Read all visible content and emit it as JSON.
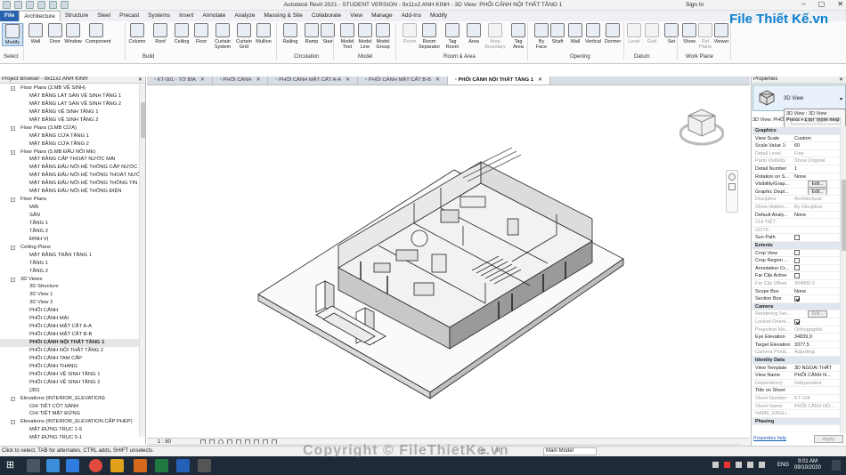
{
  "title_bar": {
    "title": "Autodesk Revit 2021 - STUDENT VERSION - 9x11x2 ANH KINH - 3D View: PHỐI CẢNH NỘI THẤT TẦNG 1",
    "sign_in": "Sign In"
  },
  "logo": "File Thiết Kế.vn",
  "tabs": [
    "File",
    "Architecture",
    "Structure",
    "Steel",
    "Precast",
    "Systems",
    "Insert",
    "Annotate",
    "Analyze",
    "Massing & Site",
    "Collaborate",
    "View",
    "Manage",
    "Add-Ins",
    "Modify"
  ],
  "active_tab": "Architecture",
  "ribbon": {
    "buttons": [
      {
        "label": "Modify",
        "icon": "cursor-icon"
      },
      {
        "label": "Wall",
        "icon": "wall-icon"
      },
      {
        "label": "Door",
        "icon": "door-icon"
      },
      {
        "label": "Window",
        "icon": "window-icon"
      },
      {
        "label": "Component",
        "icon": "component-icon"
      },
      {
        "label": "Column",
        "icon": "column-icon"
      },
      {
        "label": "Roof",
        "icon": "roof-icon"
      },
      {
        "label": "Ceiling",
        "icon": "ceiling-icon"
      },
      {
        "label": "Floor",
        "icon": "floor-icon"
      },
      {
        "label": "Curtain\nSystem",
        "icon": "curtain-system-icon"
      },
      {
        "label": "Curtain\nGrid",
        "icon": "curtain-grid-icon"
      },
      {
        "label": "Mullion",
        "icon": "mullion-icon"
      },
      {
        "label": "Railing",
        "icon": "railing-icon"
      },
      {
        "label": "Ramp",
        "icon": "ramp-icon"
      },
      {
        "label": "Stair",
        "icon": "stair-icon"
      },
      {
        "label": "Model\nText",
        "icon": "model-text-icon"
      },
      {
        "label": "Model\nLine",
        "icon": "model-line-icon"
      },
      {
        "label": "Model\nGroup",
        "icon": "model-group-icon"
      },
      {
        "label": "Room",
        "icon": "room-icon"
      },
      {
        "label": "Room\nSeparator",
        "icon": "room-separator-icon"
      },
      {
        "label": "Tag\nRoom",
        "icon": "tag-room-icon"
      },
      {
        "label": "Area",
        "icon": "area-icon"
      },
      {
        "label": "Area\nBoundary",
        "icon": "area-boundary-icon"
      },
      {
        "label": "Tag\nArea",
        "icon": "tag-area-icon"
      },
      {
        "label": "By\nFace",
        "icon": "by-face-icon"
      },
      {
        "label": "Shaft",
        "icon": "shaft-icon"
      },
      {
        "label": "Wall",
        "icon": "wall-opening-icon"
      },
      {
        "label": "Vertical",
        "icon": "vertical-opening-icon"
      },
      {
        "label": "Dormer",
        "icon": "dormer-icon"
      },
      {
        "label": "Level",
        "icon": "level-icon"
      },
      {
        "label": "Grid",
        "icon": "grid-icon"
      },
      {
        "label": "Set",
        "icon": "set-icon"
      },
      {
        "label": "Show",
        "icon": "show-icon"
      },
      {
        "label": "Ref\nPlane",
        "icon": "ref-plane-icon"
      },
      {
        "label": "Viewer",
        "icon": "viewer-icon"
      }
    ],
    "groups": [
      "Select",
      "Build",
      "Circulation",
      "Model",
      "Room & Area",
      "Opening",
      "Datum",
      "Work Plane"
    ]
  },
  "project_browser": {
    "title": "Project Browser - 9x11x2 ANH KINH",
    "items": [
      {
        "label": "Floor Plans (2.MB VỆ SINH)",
        "level": 1,
        "toggle": "-"
      },
      {
        "label": "MẶT BẰNG LÁT SÀN VỆ SINH TẦNG 1",
        "level": 2
      },
      {
        "label": "MẶT BẰNG LÁT SÀN VỆ SINH TẦNG 2",
        "level": 2
      },
      {
        "label": "MẶT BẰNG VỆ SINH TẦNG 1",
        "level": 2
      },
      {
        "label": "MẶT BẰNG VỆ SINH TẦNG 2",
        "level": 2
      },
      {
        "label": "Floor Plans (3.MB CỬA)",
        "level": 1,
        "toggle": "-"
      },
      {
        "label": "MẶT BẰNG CỬA TẦNG 1",
        "level": 2
      },
      {
        "label": "MẶT BẰNG CỬA TẦNG 2",
        "level": 2
      },
      {
        "label": "Floor Plans (5.MB ĐẤU NỐI ME)",
        "level": 1,
        "toggle": "-"
      },
      {
        "label": "MẶT BẰNG CẤP THOÁT NƯỚC MÁI",
        "level": 2
      },
      {
        "label": "MẶT BẰNG ĐẤU NỐI HỆ THỐNG CẤP NƯỚC",
        "level": 2
      },
      {
        "label": "MẶT BẰNG ĐẤU NỐI HỆ THỐNG THOÁT NƯỚC",
        "level": 2
      },
      {
        "label": "MẶT BẰNG ĐẤU NỐI HỆ THỐNG THÔNG TIN L",
        "level": 2
      },
      {
        "label": "MẶT BẰNG ĐẤU NỐI HỆ THỐNG ĐIỆN",
        "level": 2
      },
      {
        "label": "Floor Plans",
        "level": 1,
        "toggle": "-"
      },
      {
        "label": "MÁI",
        "level": 2
      },
      {
        "label": "SÂN",
        "level": 2
      },
      {
        "label": "TẦNG 1",
        "level": 2
      },
      {
        "label": "TẦNG 2",
        "level": 2
      },
      {
        "label": "ĐỊNH VỊ",
        "level": 2
      },
      {
        "label": "Ceiling Plans",
        "level": 1,
        "toggle": "-"
      },
      {
        "label": "MẶT BẰNG TRẦN TẦNG 1",
        "level": 2
      },
      {
        "label": "TẦNG 1",
        "level": 2
      },
      {
        "label": "TẦNG 2",
        "level": 2
      },
      {
        "label": "3D Views",
        "level": 1,
        "toggle": "-"
      },
      {
        "label": "3D Structure",
        "level": 2
      },
      {
        "label": "3D View 1",
        "level": 2
      },
      {
        "label": "3D View 2",
        "level": 2
      },
      {
        "label": "PHỐI CẢNH",
        "level": 2
      },
      {
        "label": "PHỐI CẢNH MÁI",
        "level": 2
      },
      {
        "label": "PHỐI CẢNH MẶT CẮT A-A",
        "level": 2
      },
      {
        "label": "PHỐI CẢNH MẶT CẮT B-B",
        "level": 2
      },
      {
        "label": "PHỐI CẢNH NỘI THẤT TẦNG 1",
        "level": 2,
        "selected": true
      },
      {
        "label": "PHỐI CẢNH NỘI THẤT TẦNG 2",
        "level": 2
      },
      {
        "label": "PHỐI CẢNH TAM CẤP",
        "level": 2
      },
      {
        "label": "PHỐI CẢNH THANG",
        "level": 2
      },
      {
        "label": "PHỐI CẢNH VỆ SINH TẦNG 1",
        "level": 2
      },
      {
        "label": "PHỐI CẢNH VỆ SINH TẦNG 2",
        "level": 2
      },
      {
        "label": "{3D}",
        "level": 2
      },
      {
        "label": "Elevations (INTERIOR_ELEVATION)",
        "level": 1,
        "toggle": "-"
      },
      {
        "label": "CHI TIẾT CỘT SẢNH",
        "level": 2
      },
      {
        "label": "CHI TIẾT MẶT ĐỨNG",
        "level": 2
      },
      {
        "label": "Elevations (INTERIOR_ELEVATION CẤP PHÉP)",
        "level": 1,
        "toggle": "-"
      },
      {
        "label": "MẶT ĐỨNG TRỤC 1-5",
        "level": 2
      },
      {
        "label": "MẶT ĐỨNG TRỤC 5-1",
        "level": 2
      }
    ]
  },
  "doc_tabs": [
    {
      "label": "KT-001 - TỜ BÌA"
    },
    {
      "label": "PHỐI CẢNH"
    },
    {
      "label": "PHỐI CẢNH MẶT CẮT A-A"
    },
    {
      "label": "PHỐI CẢNH MẶT CẮT B-B"
    },
    {
      "label": "PHỐI CẢNH NỘI THẤT TẦNG 1",
      "active": true
    }
  ],
  "viewcube": {
    "face": "FRONT"
  },
  "view_bar": {
    "scale": "1 : 60"
  },
  "properties": {
    "title": "Properties",
    "type_name": "3D View",
    "tooltip": {
      "line1": "3D View : 3D View",
      "line2": "Press F1 for more help"
    },
    "selector": "3D View: PHỐI",
    "edit_type": "Edit Type",
    "groups": [
      {
        "name": "Graphics",
        "rows": [
          {
            "k": "View Scale",
            "v": "Custom"
          },
          {
            "k": "Scale Value 1:",
            "v": "60"
          },
          {
            "k": "Detail Level",
            "v": "Fine",
            "dis": true
          },
          {
            "k": "Parts Visibility",
            "v": "Show Original",
            "dis": true
          },
          {
            "k": "Detail Number",
            "v": "1"
          },
          {
            "k": "Rotation on S...",
            "v": "None"
          },
          {
            "k": "Visibility/Grap...",
            "v": "Edit...",
            "btn": true
          },
          {
            "k": "Graphic Displ...",
            "v": "Edit...",
            "btn": true
          },
          {
            "k": "Discipline",
            "v": "Architectural",
            "dis": true
          },
          {
            "k": "Show Hidden ...",
            "v": "By Discipline",
            "dis": true
          },
          {
            "k": "Default Analy...",
            "v": "None"
          },
          {
            "k": "CHI TIẾT",
            "v": "",
            "dis": true
          },
          {
            "k": "GDTK",
            "v": "",
            "dis": true
          },
          {
            "k": "Sun Path",
            "v": "",
            "cb": false
          }
        ]
      },
      {
        "name": "Extents",
        "rows": [
          {
            "k": "Crop View",
            "v": "",
            "cb": false
          },
          {
            "k": "Crop Region ...",
            "v": "",
            "cb": false
          },
          {
            "k": "Annotation Cr...",
            "v": "",
            "cb": false
          },
          {
            "k": "Far Clip Active",
            "v": "",
            "cb": false
          },
          {
            "k": "Far Clip Offset",
            "v": "304800,0",
            "dis": true
          },
          {
            "k": "Scope Box",
            "v": "None"
          },
          {
            "k": "Section Box",
            "v": "",
            "cb": true
          }
        ]
      },
      {
        "name": "Camera",
        "rows": [
          {
            "k": "Rendering Set...",
            "v": "Edit...",
            "btn": true,
            "dis": true
          },
          {
            "k": "Locked Orient...",
            "v": "",
            "cb": true,
            "dis": true
          },
          {
            "k": "Projection Mo...",
            "v": "Orthographic",
            "dis": true
          },
          {
            "k": "Eye Elevation",
            "v": "34839,9"
          },
          {
            "k": "Target Elevation",
            "v": "3377,5"
          },
          {
            "k": "Camera Positi...",
            "v": "Adjusting",
            "dis": true
          }
        ]
      },
      {
        "name": "Identity Data",
        "rows": [
          {
            "k": "View Template",
            "v": "3D NGOẠI THẤT"
          },
          {
            "k": "View Name",
            "v": "PHỐI CẢNH N..."
          },
          {
            "k": "Dependency",
            "v": "Independent",
            "dis": true
          },
          {
            "k": "Title on Sheet",
            "v": ""
          },
          {
            "k": "Sheet Number",
            "v": "KT-104",
            "dis": true
          },
          {
            "k": "Sheet Name",
            "v": "PHỐI CẢNH NỘ...",
            "dis": true
          },
          {
            "k": "NAME_ENGLI...",
            "v": "",
            "dis": true
          }
        ]
      },
      {
        "name": "Phasing",
        "rows": []
      }
    ],
    "help_link": "Properties help",
    "apply": "Apply"
  },
  "status_bar": {
    "hint": "Click to select, TAB for alternates, CTRL adds, SHIFT unselects.",
    "main_model": "Main Model",
    "zero": ":0"
  },
  "taskbar": {
    "time": "9:01 AM",
    "date": "09/10/2020",
    "lang": "ENG"
  },
  "watermark": "Copyright © FileThietKe.vn"
}
